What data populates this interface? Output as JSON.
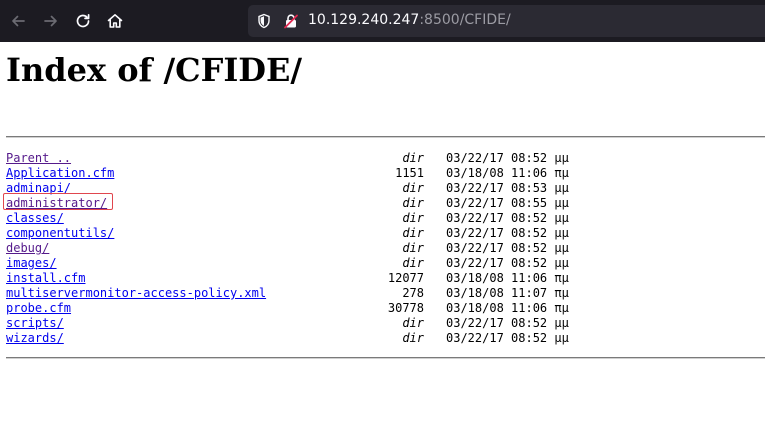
{
  "browser": {
    "url_host": "10.129.240.247",
    "url_rest": ":8500/CFIDE/",
    "icons": [
      "back-arrow-icon",
      "forward-arrow-icon",
      "reload-icon",
      "home-icon",
      "shield-icon",
      "insecure-lock-icon"
    ]
  },
  "page": {
    "title": "Index of /CFIDE/"
  },
  "listing": [
    {
      "name": "Parent ..",
      "size": "dir",
      "date": "03/22/17 08:52 μμ",
      "visited": true
    },
    {
      "name": "Application.cfm",
      "size": "1151",
      "date": "03/18/08 11:06 πμ",
      "visited": false
    },
    {
      "name": "adminapi/",
      "size": "dir",
      "date": "03/22/17 08:53 μμ",
      "visited": false
    },
    {
      "name": "administrator/",
      "size": "dir",
      "date": "03/22/17 08:55 μμ",
      "visited": true
    },
    {
      "name": "classes/",
      "size": "dir",
      "date": "03/22/17 08:52 μμ",
      "visited": false
    },
    {
      "name": "componentutils/",
      "size": "dir",
      "date": "03/22/17 08:52 μμ",
      "visited": false
    },
    {
      "name": "debug/",
      "size": "dir",
      "date": "03/22/17 08:52 μμ",
      "visited": true
    },
    {
      "name": "images/",
      "size": "dir",
      "date": "03/22/17 08:52 μμ",
      "visited": false
    },
    {
      "name": "install.cfm",
      "size": "12077",
      "date": "03/18/08 11:06 πμ",
      "visited": false
    },
    {
      "name": "multiservermonitor-access-policy.xml",
      "size": "278",
      "date": "03/18/08 11:07 πμ",
      "visited": false
    },
    {
      "name": "probe.cfm",
      "size": "30778",
      "date": "03/18/08 11:06 πμ",
      "visited": false
    },
    {
      "name": "scripts/",
      "size": "dir",
      "date": "03/22/17 08:52 μμ",
      "visited": false
    },
    {
      "name": "wizards/",
      "size": "dir",
      "date": "03/22/17 08:52 μμ",
      "visited": false
    }
  ],
  "highlight_color": "#e0464e"
}
